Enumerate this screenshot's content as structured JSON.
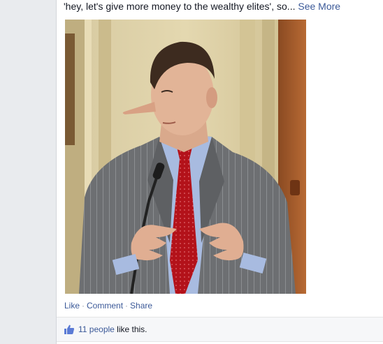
{
  "post": {
    "text_truncated": "'hey, let's give more money to the wealthy elites', so...",
    "see_more_label": "See More"
  },
  "photo": {
    "subject": "photo-of-man-in-suit-with-long-nose"
  },
  "actions": {
    "like_label": "Like",
    "comment_label": "Comment",
    "share_label": "Share",
    "separator": "·"
  },
  "likes": {
    "count_label": "11 people",
    "suffix": "like this.",
    "icon": "thumbs-up-icon"
  },
  "colors": {
    "link": "#3b5998",
    "text": "#141823",
    "muted": "#9197a3",
    "bar_bg": "#f6f7f9"
  }
}
